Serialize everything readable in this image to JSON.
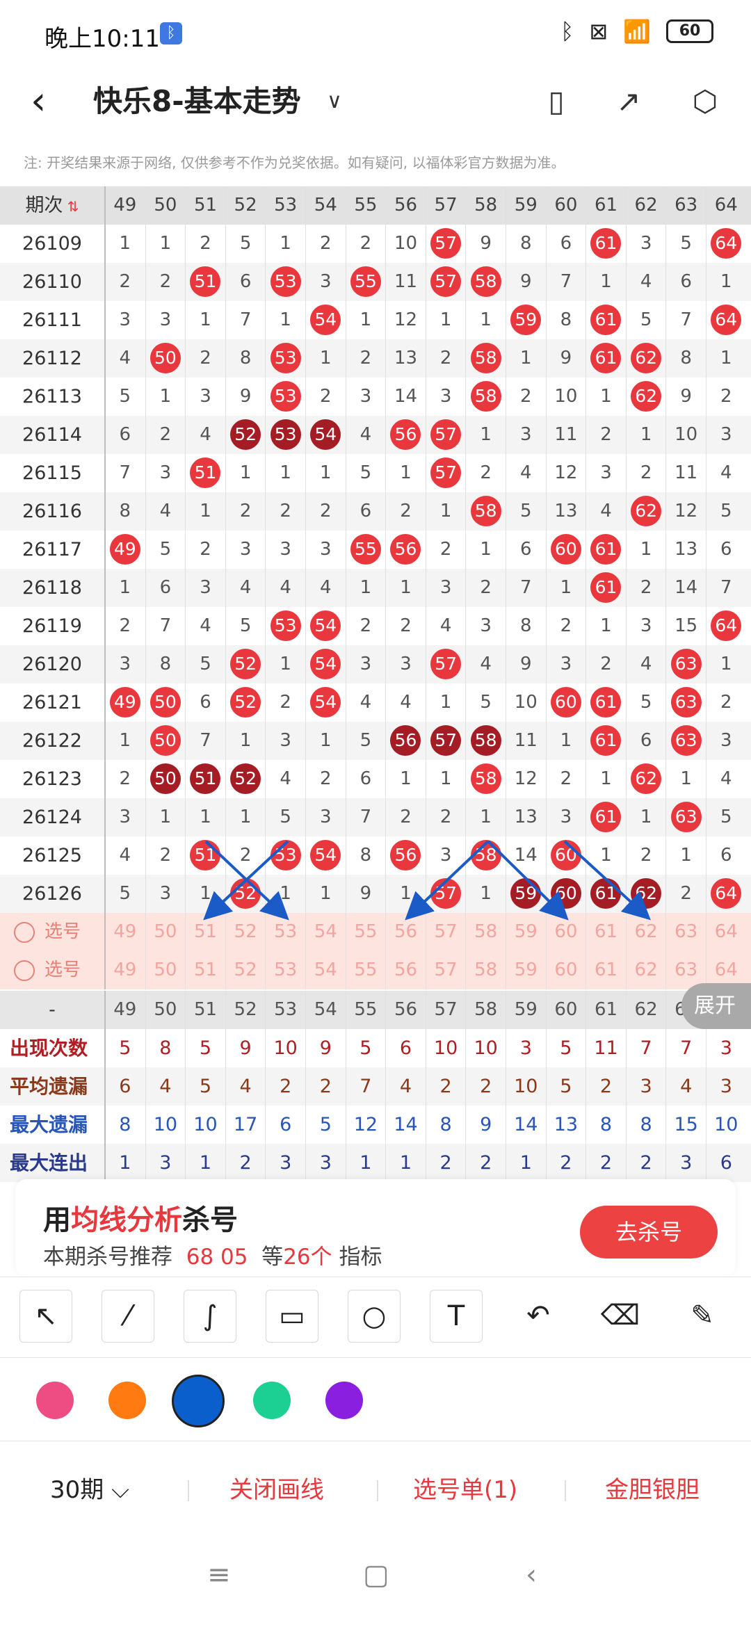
{
  "status": {
    "time": "晚上10:11",
    "battery": "60"
  },
  "header": {
    "title": "快乐8-基本走势"
  },
  "notice": "注: 开奖结果来源于网络, 仅供参考不作为兑奖依据。如有疑问, 以福体彩官方数据为准。",
  "table": {
    "period_header": "期次",
    "numbers": [
      "49",
      "50",
      "51",
      "52",
      "53",
      "54",
      "55",
      "56",
      "57",
      "58",
      "59",
      "60",
      "61",
      "62",
      "63",
      "64"
    ],
    "rows": [
      {
        "period": "26109",
        "cells": [
          "1",
          "1",
          "2",
          "5",
          "1",
          "2",
          "2",
          "10",
          "57",
          "9",
          "8",
          "6",
          "61",
          "3",
          "5",
          "64"
        ]
      },
      {
        "period": "26110",
        "cells": [
          "2",
          "2",
          "51",
          "6",
          "53",
          "3",
          "55",
          "11",
          "57",
          "58",
          "9",
          "7",
          "1",
          "4",
          "6",
          "1"
        ]
      },
      {
        "period": "26111",
        "cells": [
          "3",
          "3",
          "1",
          "7",
          "1",
          "54",
          "1",
          "12",
          "1",
          "1",
          "59",
          "8",
          "61",
          "5",
          "7",
          "64"
        ]
      },
      {
        "period": "26112",
        "cells": [
          "4",
          "50",
          "2",
          "8",
          "53",
          "1",
          "2",
          "13",
          "2",
          "58",
          "1",
          "9",
          "61",
          "62",
          "8",
          "1"
        ]
      },
      {
        "period": "26113",
        "cells": [
          "5",
          "1",
          "3",
          "9",
          "53",
          "2",
          "3",
          "14",
          "3",
          "58",
          "2",
          "10",
          "1",
          "62",
          "9",
          "2"
        ]
      },
      {
        "period": "26114",
        "cells": [
          "6",
          "2",
          "4",
          "52",
          "53",
          "54",
          "4",
          "56",
          "57",
          "1",
          "3",
          "11",
          "2",
          "1",
          "10",
          "3"
        ]
      },
      {
        "period": "26115",
        "cells": [
          "7",
          "3",
          "51",
          "1",
          "1",
          "1",
          "5",
          "1",
          "57",
          "2",
          "4",
          "12",
          "3",
          "2",
          "11",
          "4"
        ]
      },
      {
        "period": "26116",
        "cells": [
          "8",
          "4",
          "1",
          "2",
          "2",
          "2",
          "6",
          "2",
          "1",
          "58",
          "5",
          "13",
          "4",
          "62",
          "12",
          "5"
        ]
      },
      {
        "period": "26117",
        "cells": [
          "49",
          "5",
          "2",
          "3",
          "3",
          "3",
          "55",
          "56",
          "2",
          "1",
          "6",
          "60",
          "61",
          "1",
          "13",
          "6"
        ]
      },
      {
        "period": "26118",
        "cells": [
          "1",
          "6",
          "3",
          "4",
          "4",
          "4",
          "1",
          "1",
          "3",
          "2",
          "7",
          "1",
          "61",
          "2",
          "14",
          "7"
        ]
      },
      {
        "period": "26119",
        "cells": [
          "2",
          "7",
          "4",
          "5",
          "53",
          "54",
          "2",
          "2",
          "4",
          "3",
          "8",
          "2",
          "1",
          "3",
          "15",
          "64"
        ]
      },
      {
        "period": "26120",
        "cells": [
          "3",
          "8",
          "5",
          "52",
          "1",
          "54",
          "3",
          "3",
          "57",
          "4",
          "9",
          "3",
          "2",
          "4",
          "63",
          "1"
        ]
      },
      {
        "period": "26121",
        "cells": [
          "49",
          "50",
          "6",
          "52",
          "2",
          "54",
          "4",
          "4",
          "1",
          "5",
          "10",
          "60",
          "61",
          "5",
          "63",
          "2"
        ]
      },
      {
        "period": "26122",
        "cells": [
          "1",
          "50",
          "7",
          "1",
          "3",
          "1",
          "5",
          "56",
          "57",
          "58",
          "11",
          "1",
          "61",
          "6",
          "63",
          "3"
        ]
      },
      {
        "period": "26123",
        "cells": [
          "2",
          "50",
          "51",
          "52",
          "4",
          "2",
          "6",
          "1",
          "1",
          "58",
          "12",
          "2",
          "1",
          "62",
          "1",
          "4"
        ]
      },
      {
        "period": "26124",
        "cells": [
          "3",
          "1",
          "1",
          "1",
          "5",
          "3",
          "7",
          "2",
          "2",
          "1",
          "13",
          "3",
          "61",
          "1",
          "63",
          "5"
        ]
      },
      {
        "period": "26125",
        "cells": [
          "4",
          "2",
          "51",
          "2",
          "53",
          "54",
          "8",
          "56",
          "3",
          "58",
          "14",
          "60",
          "1",
          "2",
          "1",
          "6"
        ]
      },
      {
        "period": "26126",
        "cells": [
          "5",
          "3",
          "1",
          "52",
          "1",
          "1",
          "9",
          "1",
          "57",
          "1",
          "59",
          "60",
          "61",
          "62",
          "2",
          "64"
        ]
      }
    ],
    "select_label": "选号",
    "select_rows": [
      {
        "cells": [
          "49",
          "50",
          "51",
          "52",
          "53",
          "54",
          "55",
          "56",
          "57",
          "58",
          "59",
          "60",
          "61",
          "62",
          "63",
          "64"
        ]
      },
      {
        "cells": [
          "49",
          "50",
          "51",
          "52",
          "53",
          "54",
          "55",
          "56",
          "57",
          "58",
          "59",
          "60",
          "61",
          "62",
          "63",
          "64"
        ]
      }
    ],
    "stats_header_dash": "-",
    "stats": [
      {
        "label": "出现次数",
        "color": "#b01e23",
        "values": [
          "5",
          "8",
          "5",
          "9",
          "10",
          "9",
          "5",
          "6",
          "10",
          "10",
          "3",
          "5",
          "11",
          "7",
          "7",
          "3"
        ]
      },
      {
        "label": "平均遗漏",
        "color": "#8a3a1a",
        "values": [
          "6",
          "4",
          "5",
          "4",
          "2",
          "2",
          "7",
          "4",
          "2",
          "2",
          "10",
          "5",
          "2",
          "3",
          "4",
          "3"
        ]
      },
      {
        "label": "最大遗漏",
        "color": "#2855b8",
        "values": [
          "8",
          "10",
          "10",
          "17",
          "6",
          "5",
          "12",
          "14",
          "8",
          "9",
          "14",
          "13",
          "8",
          "8",
          "15",
          "10"
        ]
      },
      {
        "label": "最大连出",
        "color": "#2a3a8a",
        "values": [
          "1",
          "3",
          "1",
          "2",
          "3",
          "3",
          "1",
          "1",
          "2",
          "2",
          "1",
          "2",
          "2",
          "2",
          "3",
          "6"
        ]
      }
    ],
    "expand_label": "展开"
  },
  "promo": {
    "title_prefix": "用",
    "title_highlight": "均线分析",
    "title_suffix": "杀号",
    "sub_prefix": "本期杀号推荐",
    "sub_numbers": "68 05",
    "sub_mid": "等",
    "sub_count": "26个",
    "sub_suffix": "指标",
    "button": "去杀号"
  },
  "drawing_tools": [
    "arrow-tool",
    "line-tool",
    "curve-tool",
    "rectangle-tool",
    "circle-tool",
    "text-tool",
    "undo-tool",
    "eraser-tool",
    "clear-tool"
  ],
  "colors": [
    "#ee4d84",
    "#ff7a10",
    "#0b5fcc",
    "#1ccf93",
    "#8a1fe0"
  ],
  "selected_color": "#0b5fcc",
  "bottom": {
    "periods": "30期",
    "close_lines": "关闭画线",
    "selection_list": "选号单(1)",
    "golden": "金胆银胆"
  }
}
